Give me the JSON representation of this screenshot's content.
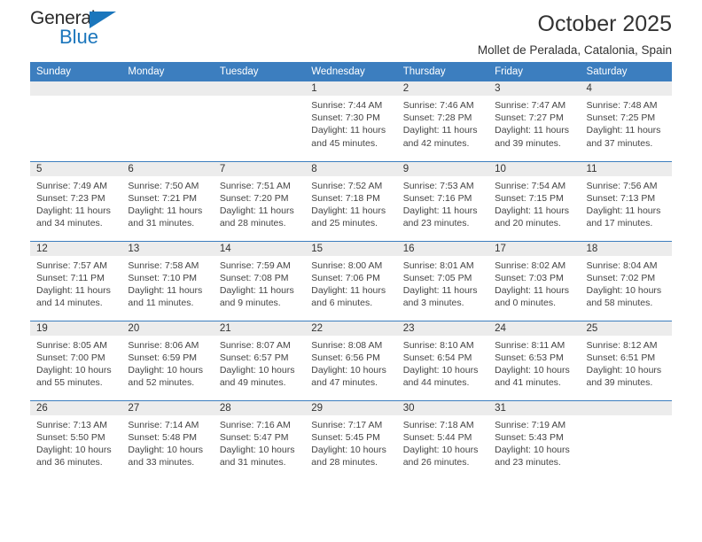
{
  "brand": {
    "name_top": "General",
    "name_bottom": "Blue",
    "triangle_color": "#1b76bc",
    "text_color": "#2b2b2b"
  },
  "header": {
    "title": "October 2025",
    "subtitle": "Mollet de Peralada, Catalonia, Spain"
  },
  "theme": {
    "header_bg": "#3c7ebf",
    "header_text": "#ffffff",
    "daynum_bg": "#ececec",
    "cell_bg": "#ffffff",
    "grid_line": "#3c7ebf",
    "body_text": "#444444"
  },
  "weekdays": [
    "Sunday",
    "Monday",
    "Tuesday",
    "Wednesday",
    "Thursday",
    "Friday",
    "Saturday"
  ],
  "labels": {
    "sunrise": "Sunrise:",
    "sunset": "Sunset:",
    "daylight": "Daylight:"
  },
  "weeks": [
    [
      {
        "day": "",
        "sunrise": "",
        "sunset": "",
        "daylight": ""
      },
      {
        "day": "",
        "sunrise": "",
        "sunset": "",
        "daylight": ""
      },
      {
        "day": "",
        "sunrise": "",
        "sunset": "",
        "daylight": ""
      },
      {
        "day": "1",
        "sunrise": "Sunrise: 7:44 AM",
        "sunset": "Sunset: 7:30 PM",
        "daylight": "Daylight: 11 hours and 45 minutes."
      },
      {
        "day": "2",
        "sunrise": "Sunrise: 7:46 AM",
        "sunset": "Sunset: 7:28 PM",
        "daylight": "Daylight: 11 hours and 42 minutes."
      },
      {
        "day": "3",
        "sunrise": "Sunrise: 7:47 AM",
        "sunset": "Sunset: 7:27 PM",
        "daylight": "Daylight: 11 hours and 39 minutes."
      },
      {
        "day": "4",
        "sunrise": "Sunrise: 7:48 AM",
        "sunset": "Sunset: 7:25 PM",
        "daylight": "Daylight: 11 hours and 37 minutes."
      }
    ],
    [
      {
        "day": "5",
        "sunrise": "Sunrise: 7:49 AM",
        "sunset": "Sunset: 7:23 PM",
        "daylight": "Daylight: 11 hours and 34 minutes."
      },
      {
        "day": "6",
        "sunrise": "Sunrise: 7:50 AM",
        "sunset": "Sunset: 7:21 PM",
        "daylight": "Daylight: 11 hours and 31 minutes."
      },
      {
        "day": "7",
        "sunrise": "Sunrise: 7:51 AM",
        "sunset": "Sunset: 7:20 PM",
        "daylight": "Daylight: 11 hours and 28 minutes."
      },
      {
        "day": "8",
        "sunrise": "Sunrise: 7:52 AM",
        "sunset": "Sunset: 7:18 PM",
        "daylight": "Daylight: 11 hours and 25 minutes."
      },
      {
        "day": "9",
        "sunrise": "Sunrise: 7:53 AM",
        "sunset": "Sunset: 7:16 PM",
        "daylight": "Daylight: 11 hours and 23 minutes."
      },
      {
        "day": "10",
        "sunrise": "Sunrise: 7:54 AM",
        "sunset": "Sunset: 7:15 PM",
        "daylight": "Daylight: 11 hours and 20 minutes."
      },
      {
        "day": "11",
        "sunrise": "Sunrise: 7:56 AM",
        "sunset": "Sunset: 7:13 PM",
        "daylight": "Daylight: 11 hours and 17 minutes."
      }
    ],
    [
      {
        "day": "12",
        "sunrise": "Sunrise: 7:57 AM",
        "sunset": "Sunset: 7:11 PM",
        "daylight": "Daylight: 11 hours and 14 minutes."
      },
      {
        "day": "13",
        "sunrise": "Sunrise: 7:58 AM",
        "sunset": "Sunset: 7:10 PM",
        "daylight": "Daylight: 11 hours and 11 minutes."
      },
      {
        "day": "14",
        "sunrise": "Sunrise: 7:59 AM",
        "sunset": "Sunset: 7:08 PM",
        "daylight": "Daylight: 11 hours and 9 minutes."
      },
      {
        "day": "15",
        "sunrise": "Sunrise: 8:00 AM",
        "sunset": "Sunset: 7:06 PM",
        "daylight": "Daylight: 11 hours and 6 minutes."
      },
      {
        "day": "16",
        "sunrise": "Sunrise: 8:01 AM",
        "sunset": "Sunset: 7:05 PM",
        "daylight": "Daylight: 11 hours and 3 minutes."
      },
      {
        "day": "17",
        "sunrise": "Sunrise: 8:02 AM",
        "sunset": "Sunset: 7:03 PM",
        "daylight": "Daylight: 11 hours and 0 minutes."
      },
      {
        "day": "18",
        "sunrise": "Sunrise: 8:04 AM",
        "sunset": "Sunset: 7:02 PM",
        "daylight": "Daylight: 10 hours and 58 minutes."
      }
    ],
    [
      {
        "day": "19",
        "sunrise": "Sunrise: 8:05 AM",
        "sunset": "Sunset: 7:00 PM",
        "daylight": "Daylight: 10 hours and 55 minutes."
      },
      {
        "day": "20",
        "sunrise": "Sunrise: 8:06 AM",
        "sunset": "Sunset: 6:59 PM",
        "daylight": "Daylight: 10 hours and 52 minutes."
      },
      {
        "day": "21",
        "sunrise": "Sunrise: 8:07 AM",
        "sunset": "Sunset: 6:57 PM",
        "daylight": "Daylight: 10 hours and 49 minutes."
      },
      {
        "day": "22",
        "sunrise": "Sunrise: 8:08 AM",
        "sunset": "Sunset: 6:56 PM",
        "daylight": "Daylight: 10 hours and 47 minutes."
      },
      {
        "day": "23",
        "sunrise": "Sunrise: 8:10 AM",
        "sunset": "Sunset: 6:54 PM",
        "daylight": "Daylight: 10 hours and 44 minutes."
      },
      {
        "day": "24",
        "sunrise": "Sunrise: 8:11 AM",
        "sunset": "Sunset: 6:53 PM",
        "daylight": "Daylight: 10 hours and 41 minutes."
      },
      {
        "day": "25",
        "sunrise": "Sunrise: 8:12 AM",
        "sunset": "Sunset: 6:51 PM",
        "daylight": "Daylight: 10 hours and 39 minutes."
      }
    ],
    [
      {
        "day": "26",
        "sunrise": "Sunrise: 7:13 AM",
        "sunset": "Sunset: 5:50 PM",
        "daylight": "Daylight: 10 hours and 36 minutes."
      },
      {
        "day": "27",
        "sunrise": "Sunrise: 7:14 AM",
        "sunset": "Sunset: 5:48 PM",
        "daylight": "Daylight: 10 hours and 33 minutes."
      },
      {
        "day": "28",
        "sunrise": "Sunrise: 7:16 AM",
        "sunset": "Sunset: 5:47 PM",
        "daylight": "Daylight: 10 hours and 31 minutes."
      },
      {
        "day": "29",
        "sunrise": "Sunrise: 7:17 AM",
        "sunset": "Sunset: 5:45 PM",
        "daylight": "Daylight: 10 hours and 28 minutes."
      },
      {
        "day": "30",
        "sunrise": "Sunrise: 7:18 AM",
        "sunset": "Sunset: 5:44 PM",
        "daylight": "Daylight: 10 hours and 26 minutes."
      },
      {
        "day": "31",
        "sunrise": "Sunrise: 7:19 AM",
        "sunset": "Sunset: 5:43 PM",
        "daylight": "Daylight: 10 hours and 23 minutes."
      },
      {
        "day": "",
        "sunrise": "",
        "sunset": "",
        "daylight": ""
      }
    ]
  ]
}
